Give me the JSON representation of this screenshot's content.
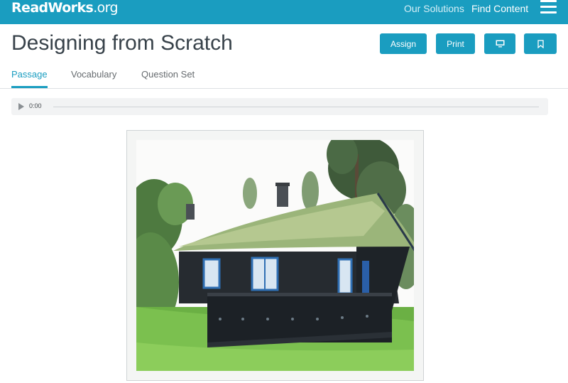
{
  "header": {
    "logo_main": "ReadWorks",
    "logo_org": ".org",
    "nav": [
      "Our Solutions",
      "Find Content"
    ],
    "menu_icon": "hamburger-menu-icon",
    "brand_color": "#1a9dc0"
  },
  "page": {
    "title": "Designing from Scratch",
    "buttons": {
      "assign": "Assign",
      "print": "Print",
      "present_icon": "monitor-icon",
      "bookmark_icon": "bookmark-icon"
    }
  },
  "tabs": {
    "items": [
      "Passage",
      "Vocabulary",
      "Question Set"
    ],
    "active": "Passage"
  },
  "audio": {
    "time": "0:00",
    "play_icon": "play-icon",
    "progress": 0
  },
  "passage": {
    "image": "photo of a dark wooden cabin with a grass-covered roof"
  }
}
